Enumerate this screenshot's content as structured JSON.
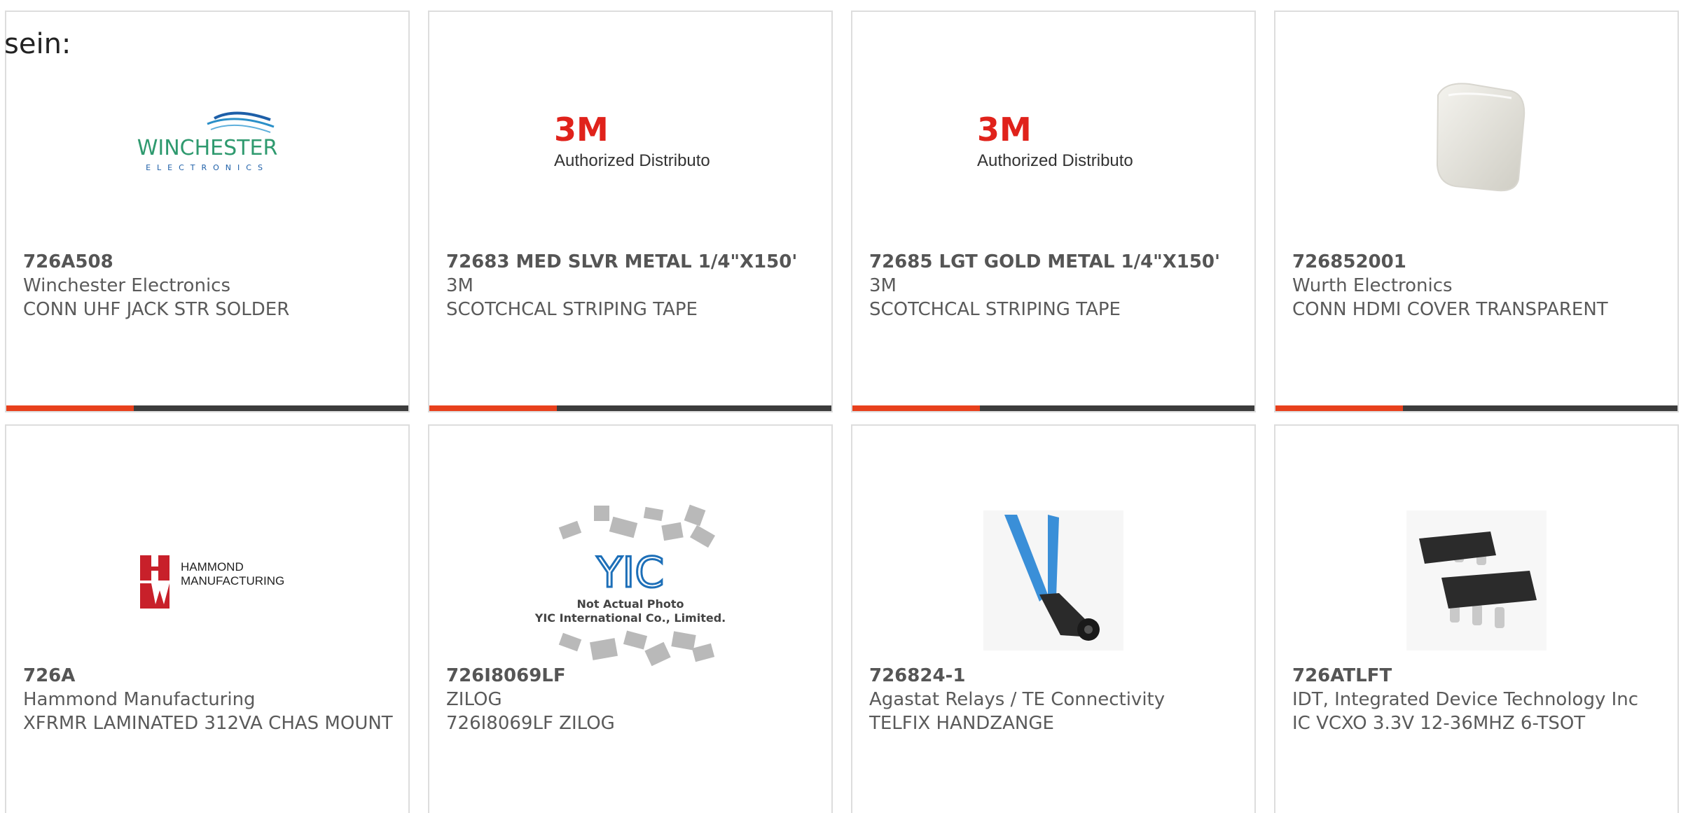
{
  "lead_text": "sein:",
  "colors": {
    "accent": "#e8401c",
    "bar": "#3c3c3c",
    "text": "#5a5a5a",
    "border": "#dddddd"
  },
  "products": [
    {
      "part_number": "726A508",
      "manufacturer": "Winchester Electronics",
      "description": "CONN UHF JACK STR SOLDER",
      "image": "winchester-electronics-logo",
      "logo_main": "WINCHESTER",
      "logo_sub": "ELECTRONICS"
    },
    {
      "part_number": "72683 MED SLVR METAL 1/4\"X150'",
      "manufacturer": "3M",
      "description": "SCOTCHCAL STRIPING TAPE",
      "image": "3m-authorized-distributor-logo",
      "logo_main": "3M",
      "logo_sub": "Authorized Distributor"
    },
    {
      "part_number": "72685 LGT GOLD METAL 1/4\"X150'",
      "manufacturer": "3M",
      "description": "SCOTCHCAL STRIPING TAPE",
      "image": "3m-authorized-distributor-logo",
      "logo_main": "3M",
      "logo_sub": "Authorized Distributor"
    },
    {
      "part_number": "726852001",
      "manufacturer": "Wurth Electronics",
      "description": "CONN HDMI COVER TRANSPARENT",
      "image": "hdmi-cover-photo"
    },
    {
      "part_number": "726A",
      "manufacturer": "Hammond Manufacturing",
      "description": "XFRMR LAMINATED 312VA CHAS MOUNT",
      "image": "hammond-manufacturing-logo",
      "logo_main": "HAMMOND",
      "logo_sub": "MANUFACTURING"
    },
    {
      "part_number": "726I8069LF",
      "manufacturer": "ZILOG",
      "description": "726I8069LF ZILOG",
      "image": "not-actual-photo-placeholder",
      "logo_main": "YIC",
      "logo_sub": "Not Actual Photo",
      "logo_sub2": "YIC International Co., Limited."
    },
    {
      "part_number": "726824-1",
      "manufacturer": "Agastat Relays / TE Connectivity",
      "description": "TELFIX HANDZANGE",
      "image": "crimping-tool-photo"
    },
    {
      "part_number": "726ATLFT",
      "manufacturer": "IDT, Integrated Device Technology Inc",
      "description": "IC VCXO 3.3V 12-36MHZ 6-TSOT",
      "image": "tsot-chip-photo"
    }
  ]
}
